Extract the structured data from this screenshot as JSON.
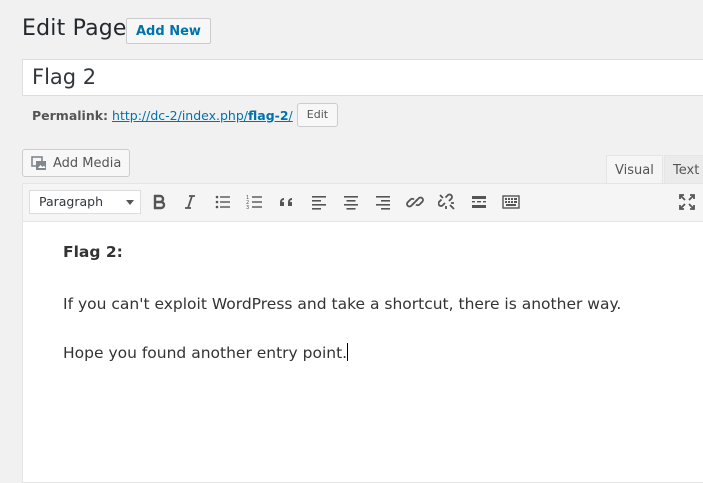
{
  "header": {
    "title": "Edit Page",
    "add_new_label": "Add New"
  },
  "post_title": "Flag 2",
  "permalink": {
    "label": "Permalink:",
    "url_prefix": "http://dc-2/index.php/",
    "slug": "flag-2",
    "url_suffix": "/",
    "edit_label": "Edit"
  },
  "media": {
    "add_media_label": "Add Media"
  },
  "editor_tabs": {
    "visual": "Visual",
    "text": "Text"
  },
  "toolbar": {
    "format_value": "Paragraph",
    "buttons": [
      "bold-icon",
      "italic-icon",
      "bulleted-list-icon",
      "numbered-list-icon",
      "blockquote-icon",
      "align-left-icon",
      "align-center-icon",
      "align-right-icon",
      "insert-link-icon",
      "remove-link-icon",
      "read-more-icon",
      "toolbar-toggle-icon",
      "fullscreen-icon"
    ]
  },
  "content": {
    "heading": "Flag 2:",
    "paragraph_1": "If you can't exploit WordPress and take a shortcut, there is another way.",
    "paragraph_2": "Hope you found another entry point."
  },
  "colors": {
    "accent": "#0073aa",
    "background": "#f1f1f1"
  }
}
